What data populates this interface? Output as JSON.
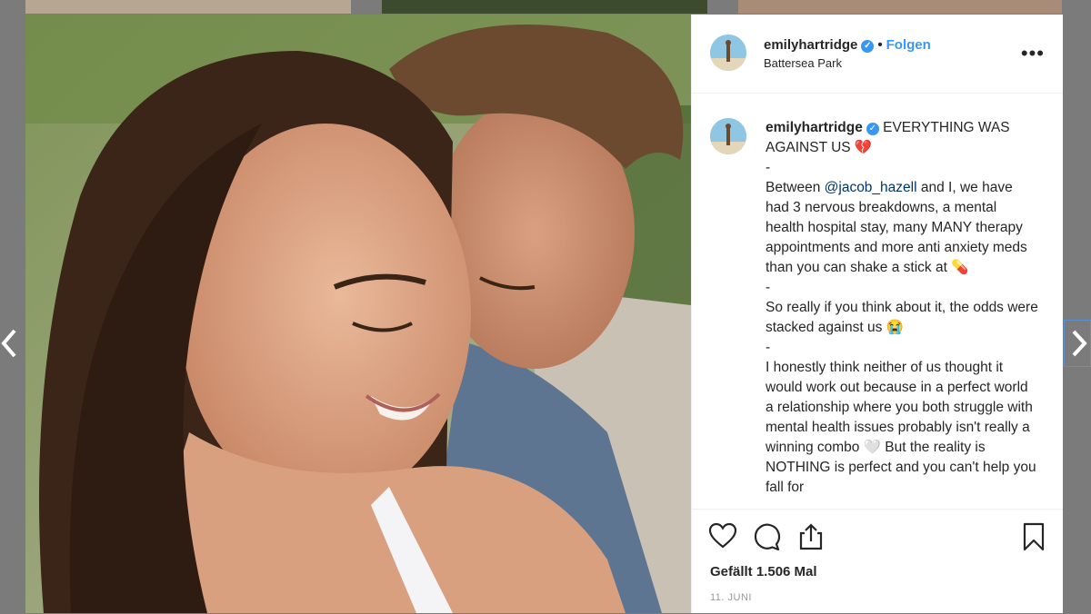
{
  "post": {
    "username": "emilyhartridge",
    "follow_label": "Folgen",
    "separator": "•",
    "location": "Battersea Park",
    "more_label": "•••"
  },
  "caption": {
    "username": "emilyhartridge",
    "title": "EVERYTHING WAS AGAINST US 💔",
    "dash1": "-",
    "p1_pre": "Between ",
    "p1_mention": "@jacob_hazell",
    "p1_post": " and I, we have had 3 nervous breakdowns, a mental health hospital stay, many MANY therapy appointments and more anti anxiety meds than you can shake a stick at 💊",
    "dash2": "-",
    "p2": "So really if you think about it, the odds were stacked against us 😭",
    "dash3": "-",
    "p3": "I honestly think neither of us thought it would work out because in a perfect world a relationship where you both struggle with mental health issues probably isn't really a winning combo 🤍 But the reality is NOTHING is perfect and you can't help you fall for"
  },
  "stats": {
    "likes": "Gefällt 1.506 Mal",
    "date": "11. JUNI"
  },
  "icons": {
    "like": "heart-icon",
    "comment": "comment-icon",
    "share": "share-icon",
    "save": "bookmark-icon",
    "prev": "chevron-left-icon",
    "next": "chevron-right-icon"
  }
}
